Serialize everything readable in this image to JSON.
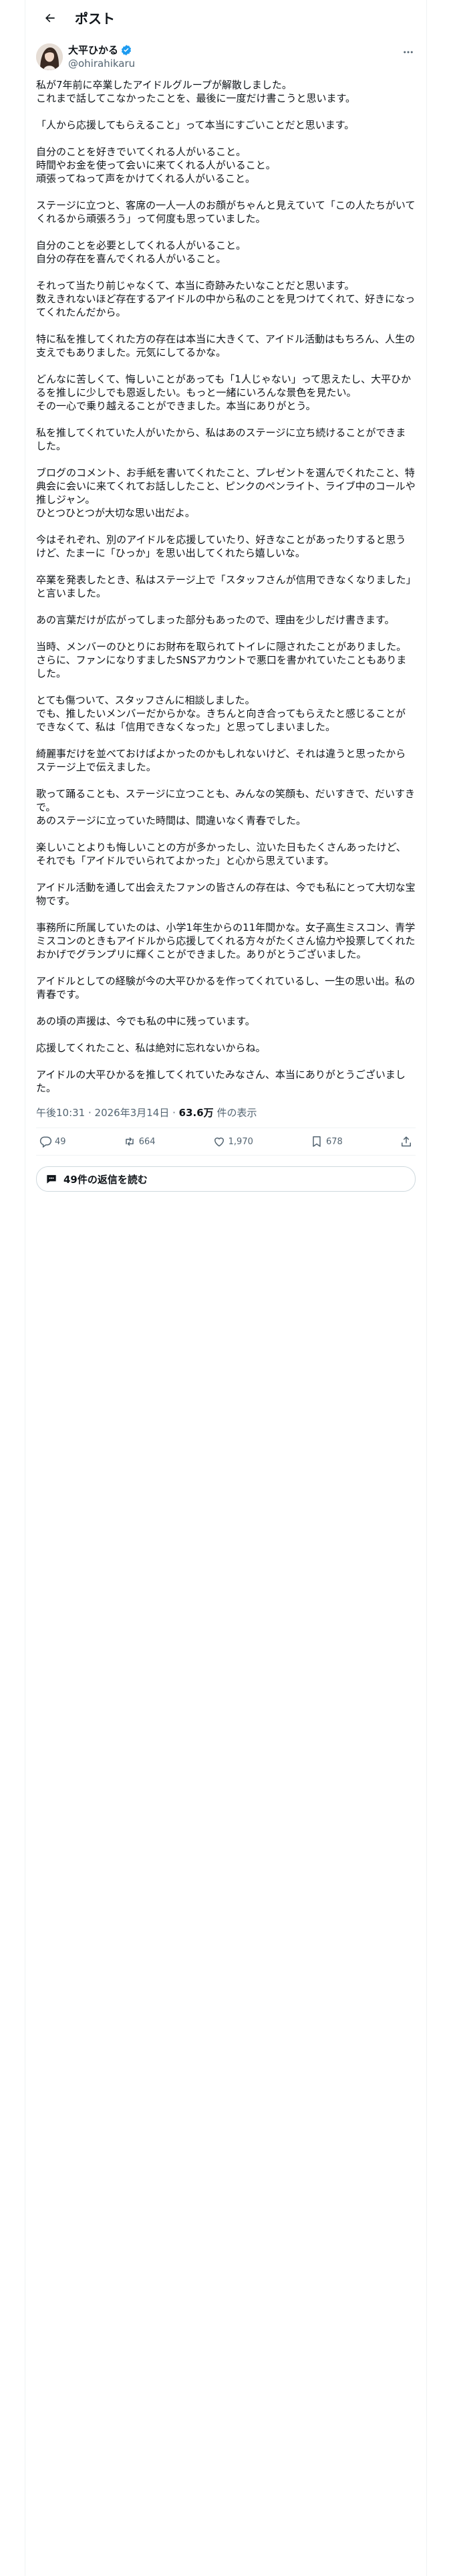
{
  "header": {
    "title": "ポスト"
  },
  "author": {
    "display_name": "大平ひかる",
    "handle": "@ohirahikaru"
  },
  "post": {
    "text": "私が7年前に卒業したアイドルグループが解散しました。\nこれまで話してこなかったことを、最後に一度だけ書こうと思います。\n\n「人から応援してもらえること」って本当にすごいことだと思います。\n\n自分のことを好きでいてくれる人がいること。\n時間やお金を使って会いに来てくれる人がいること。\n頑張ってねって声をかけてくれる人がいること。\n\nステージに立つと、客席の一人一人のお顔がちゃんと見えていて「この人たちがいてくれるから頑張ろう」って何度も思っていました。\n\n自分のことを必要としてくれる人がいること。\n自分の存在を喜んでくれる人がいること。\n\nそれって当たり前じゃなくて、本当に奇跡みたいなことだと思います。\n数えきれないほど存在するアイドルの中から私のことを見つけてくれて、好きになってくれたんだから。\n\n特に私を推してくれた方の存在は本当に大きくて、アイドル活動はもちろん、人生の支えでもありました。元気にしてるかな。\n\nどんなに苦しくて、悔しいことがあっても「1人じゃない」って思えたし、大平ひかるを推しに少しでも恩返したい。もっと一緒にいろんな景色を見たい。\nその一心で乗り越えることができました。本当にありがとう。\n\n私を推してくれていた人がいたから、私はあのステージに立ち続けることができました。\n\nブログのコメント、お手紙を書いてくれたこと、プレゼントを選んでくれたこと、特典会に会いに来てくれてお話ししたこと、ピンクのペンライト、ライブ中のコールや推しジャン。\nひとつひとつが大切な思い出だよ。\n\n今はそれぞれ、別のアイドルを応援していたり、好きなことがあったりすると思うけど、たまーに「ひっか」を思い出してくれたら嬉しいな。\n\n卒業を発表したとき、私はステージ上で「スタッフさんが信用できなくなりました」と言いました。\n\nあの言葉だけが広がってしまった部分もあったので、理由を少しだけ書きます。\n\n当時、メンバーのひとりにお財布を取られてトイレに隠されたことがありました。\nさらに、ファンになりすましたSNSアカウントで悪口を書かれていたこともありました。\n\nとても傷ついて、スタッフさんに相談しました。\nでも、推したいメンバーだからかな。きちんと向き合ってもらえたと感じることができなくて、私は「信用できなくなった」と思ってしまいました。\n\n綺麗事だけを並べておけばよかったのかもしれないけど、それは違うと思ったからステージ上で伝えました。\n\n歌って踊ることも、ステージに立つことも、みんなの笑顔も、だいすきで、だいすきで。\nあのステージに立っていた時間は、間違いなく青春でした。\n\n楽しいことよりも悔しいことの方が多かったし、泣いた日もたくさんあったけど、それでも「アイドルでいられてよかった」と心から思えています。\n\nアイドル活動を通して出会えたファンの皆さんの存在は、今でも私にとって大切な宝物です。\n\n事務所に所属していたのは、小学1年生からの11年間かな。女子高生ミスコン、青学ミスコンのときもアイドルから応援してくれる方々がたくさん協力や投票してくれたおかげでグランプリに輝くことができました。ありがとうございました。\n\nアイドルとしての経験が今の大平ひかるを作ってくれているし、一生の思い出。私の青春です。\n\nあの頃の声援は、今でも私の中に残っています。\n\n応援してくれたこと、私は絶対に忘れないからね。\n\nアイドルの大平ひかるを推してくれていたみなさん、本当にありがとうございました。",
    "time": "午後10:31 · 2026年3月14日 · ",
    "views": "63.6万",
    "views_suffix": " 件の表示"
  },
  "actions": {
    "replies": "49",
    "reposts": "664",
    "likes": "1,970",
    "bookmarks": "678"
  },
  "read_replies": "49件の返信を読む",
  "colors": {
    "text": "#0f1419",
    "secondary": "#536471",
    "verified": "#1d9bf0",
    "border": "#eff3f4"
  }
}
